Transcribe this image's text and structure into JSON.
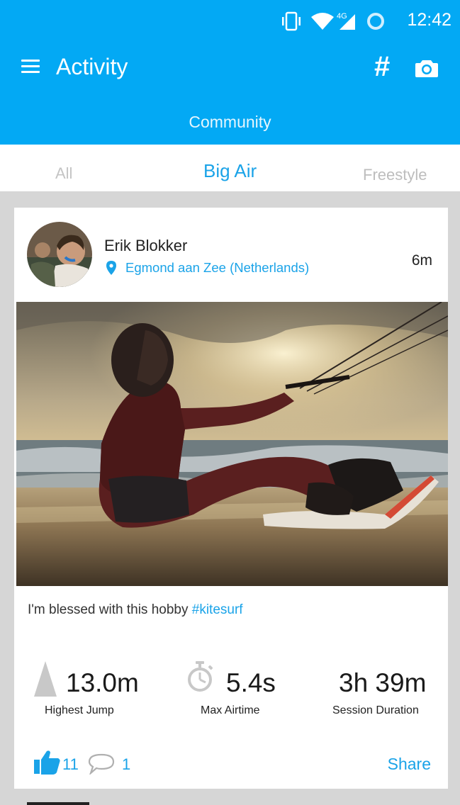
{
  "status_bar": {
    "time": "12:42",
    "network_label": "4G",
    "icons": [
      "vibrate-icon",
      "wifi-icon",
      "cellular-signal-icon",
      "data-saver-icon"
    ]
  },
  "app_bar": {
    "title": "Activity",
    "hashtag_label": "#",
    "icons": [
      "menu-icon",
      "hashtag-icon",
      "camera-icon"
    ]
  },
  "community": {
    "label": "Community"
  },
  "tabs": [
    {
      "label": "All",
      "selected": false
    },
    {
      "label": "Big Air",
      "selected": true
    },
    {
      "label": "Freestyle",
      "selected": false
    }
  ],
  "post": {
    "author": "Erik Blokker",
    "location": "Egmond aan Zee (Netherlands)",
    "time_ago": "6m",
    "caption_text": "I'm blessed with this hobby ",
    "caption_hashtag": "#kitesurf",
    "stats": [
      {
        "value": "13.0m",
        "label": "Highest Jump",
        "icon": "jump-height-icon"
      },
      {
        "value": "5.4s",
        "label": "Max Airtime",
        "icon": "stopwatch-icon"
      },
      {
        "value": "3h 39m",
        "label": "Session Duration",
        "icon": ""
      }
    ],
    "likes": "11",
    "comments": "1",
    "share_label": "Share"
  },
  "colors": {
    "primary": "#03a9f4",
    "accent_text": "#1aa3e8",
    "background": "#d6d6d6"
  }
}
